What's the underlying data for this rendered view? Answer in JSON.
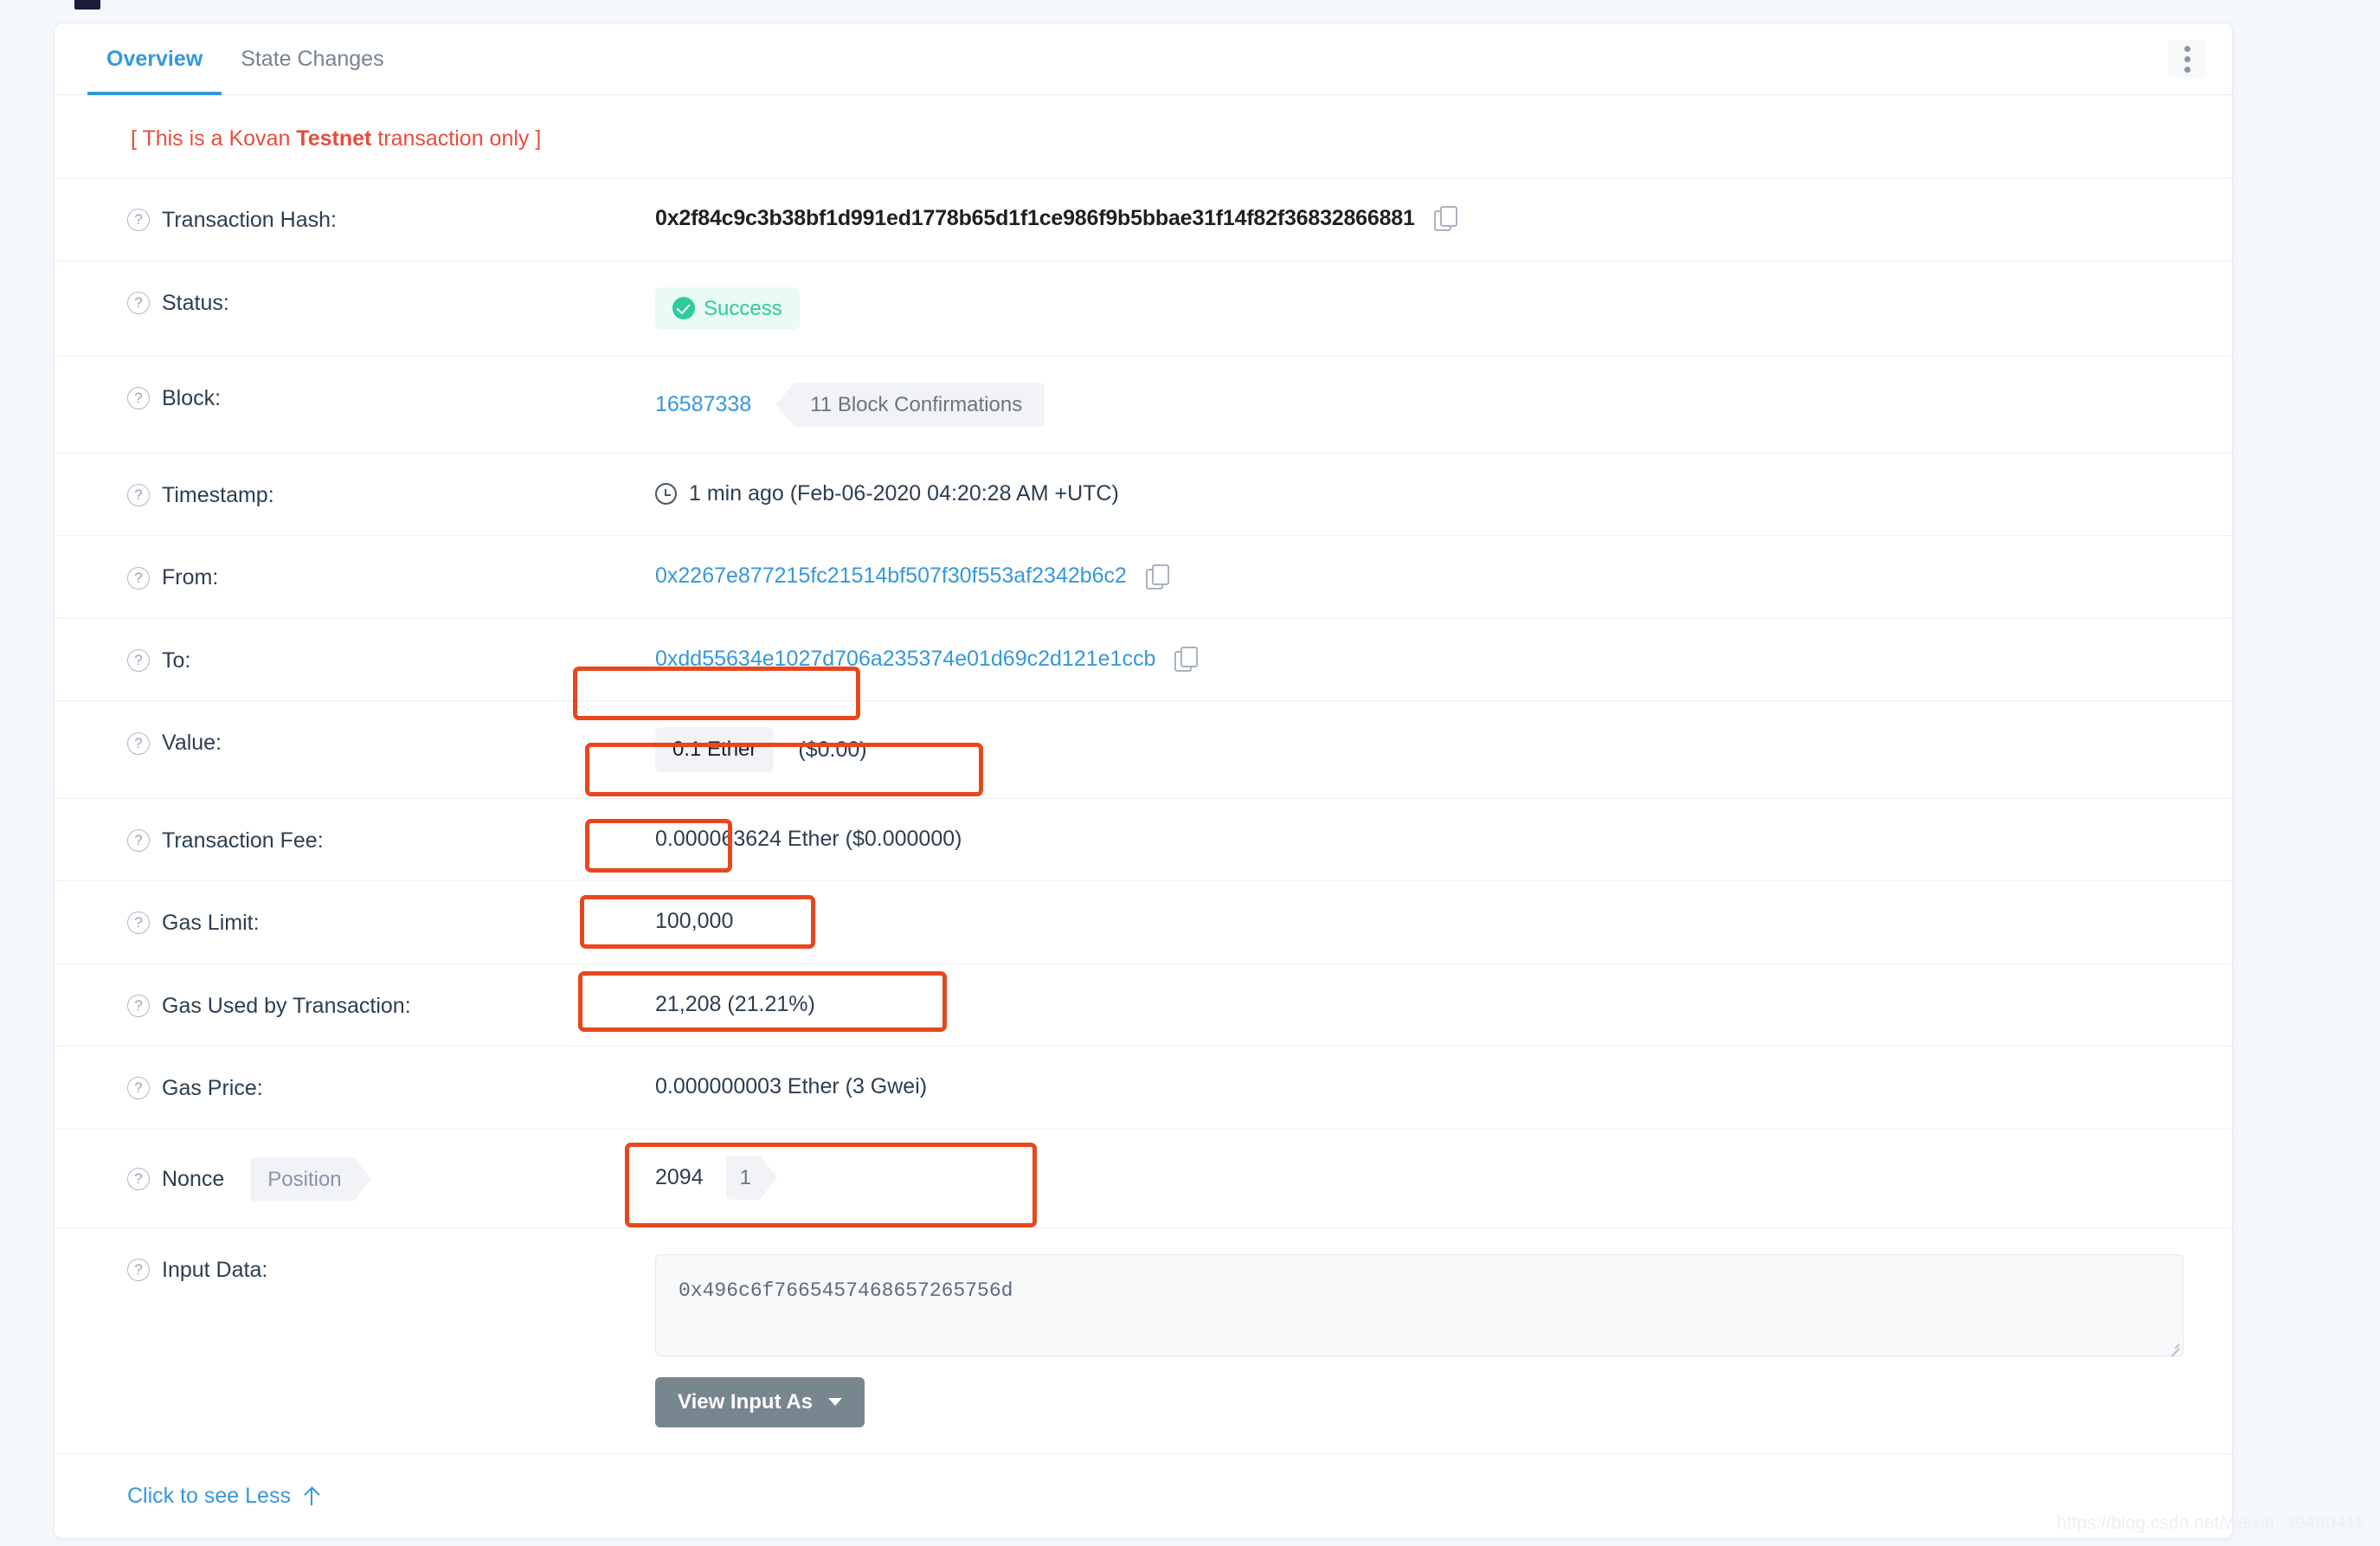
{
  "top_partial_bar": {
    "left_text": "",
    "link_text": ""
  },
  "card": {
    "tabs": [
      {
        "label": "Overview",
        "active": true
      },
      {
        "label": "State Changes",
        "active": false
      }
    ],
    "menu_icon": "kebab-menu-icon",
    "testnet_notice": {
      "prefix": "[ This is a Kovan ",
      "bold": "Testnet",
      "suffix": " transaction only ]"
    },
    "rows": {
      "transaction_hash": {
        "label": "Transaction Hash:",
        "value": "0x2f84c9c3b38bf1d991ed1778b65d1f1ce986f9b5bbae31f14f82f36832866881",
        "copy_icon": "copy-icon"
      },
      "status": {
        "label": "Status:",
        "value": "Success",
        "icon": "check-circle-icon"
      },
      "block": {
        "label": "Block:",
        "number": "16587338",
        "confirmations": "11 Block Confirmations"
      },
      "timestamp": {
        "label": "Timestamp:",
        "value": "1 min ago (Feb-06-2020 04:20:28 AM +UTC)",
        "icon": "clock-icon"
      },
      "from": {
        "label": "From:",
        "value": "0x2267e877215fc21514bf507f30f553af2342b6c2",
        "copy_icon": "copy-icon"
      },
      "to": {
        "label": "To:",
        "value": "0xdd55634e1027d706a235374e01d69c2d121e1ccb",
        "copy_icon": "copy-icon"
      },
      "value": {
        "label": "Value:",
        "ether": "0.1 Ether",
        "usd": "($0.00)"
      },
      "transaction_fee": {
        "label": "Transaction Fee:",
        "value": "0.000063624 Ether ($0.000000)"
      },
      "gas_limit": {
        "label": "Gas Limit:",
        "value": "100,000"
      },
      "gas_used": {
        "label": "Gas Used by Transaction:",
        "value": "21,208 (21.21%)"
      },
      "gas_price": {
        "label": "Gas Price:",
        "value": "0.000000003 Ether (3 Gwei)"
      },
      "nonce": {
        "label": "Nonce",
        "position_tag": "Position",
        "nonce_value": "2094",
        "position_value": "1"
      },
      "input_data": {
        "label": "Input Data:",
        "value": "0x496c6f7665457468657265756d",
        "button_label": "View Input As",
        "button_caret": "chevron-down-icon"
      }
    },
    "footer": {
      "see_less": "Click to see Less",
      "arrow_icon": "arrow-up-icon"
    }
  },
  "annotations": {
    "color": "#e8471e",
    "targets": [
      "value-row",
      "transaction-fee-row",
      "gas-limit-row",
      "gas-used-row",
      "gas-price-row",
      "input-data-field"
    ]
  },
  "watermark": "https://blog.csdn.net/weixin_39430411"
}
